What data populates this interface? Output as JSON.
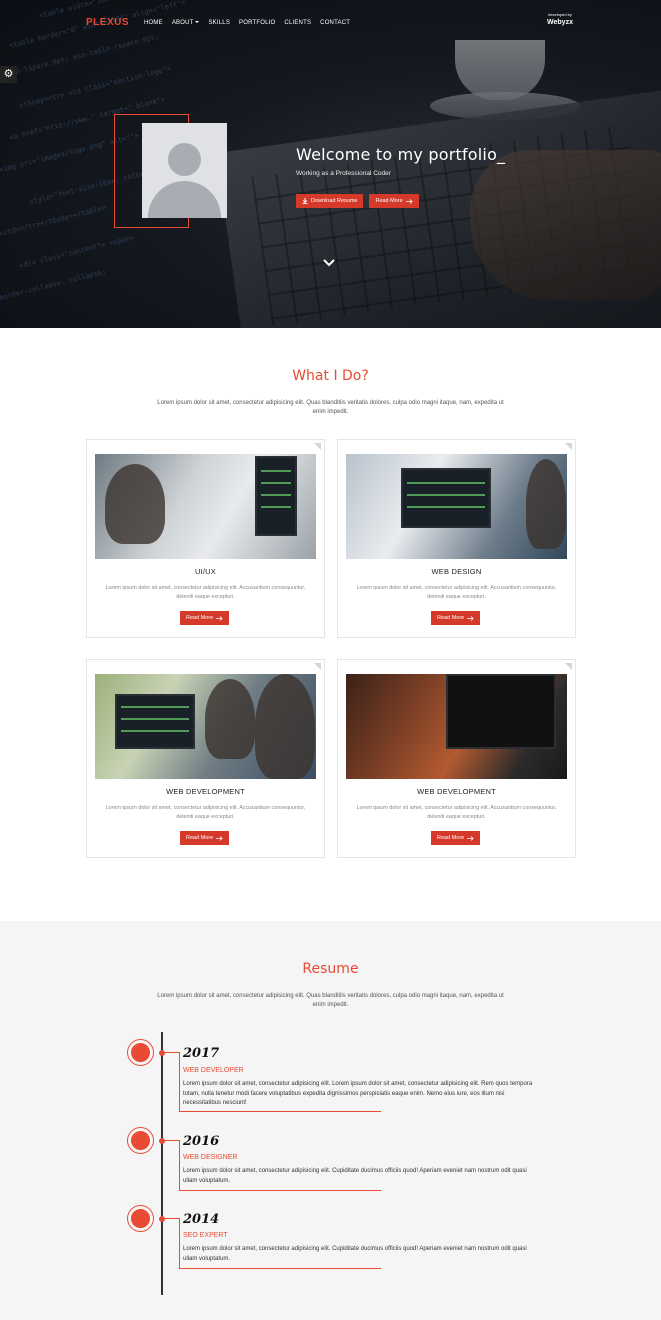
{
  "nav": {
    "logo": "PLEXUS",
    "links": [
      "HOME",
      "ABOUT",
      "SKILLS",
      "PORTFOLIO",
      "CLIENTS",
      "CONTACT"
    ],
    "developed_by": "developed by",
    "developer_brand": "Webyzx"
  },
  "hero": {
    "title": "Welcome to my portfolio_",
    "subtitle": "Working as a Professional Coder",
    "download_label": "Download Resume",
    "read_more_label": "Read More"
  },
  "services": {
    "title": "What I Do?",
    "description": "Lorem ipsum dolor sit amet, consectetur adipisicing elit. Quas blanditiis veritatis dolores, culpa odio magni itaque, nam, expedita ut enim impedit.",
    "cards": [
      {
        "title": "UI/UX",
        "desc": "Lorem ipsum dolor sit amet, consectetur adipisicing elit. Accusantium consequuntur, deleniti eaque excepturi.",
        "button": "Read More"
      },
      {
        "title": "WEB DESIGN",
        "desc": "Lorem ipsum dolor sit amet, consectetur adipisicing elit. Accusantium consequuntur, deleniti eaque excepturi.",
        "button": "Read More"
      },
      {
        "title": "WEB DEVELOPMENT",
        "desc": "Lorem ipsum dolor sit amet, consectetur adipisicing elit. Accusantium consequuntur, deleniti eaque excepturi.",
        "button": "Read More"
      },
      {
        "title": "WEB DEVELOPMENT",
        "desc": "Lorem ipsum dolor sit amet, consectetur adipisicing elit. Accusantium consequuntur, deleniti eaque excepturi.",
        "button": "Read More"
      }
    ]
  },
  "resume": {
    "title": "Resume",
    "description": "Lorem ipsum dolor sit amet, consectetur adipisicing elit. Quas blanditiis veritatis dolores, culpa odio magni itaque, nam, expedita ut enim impedit.",
    "entries": [
      {
        "year": "2017",
        "role": "WEB DEVELOPER",
        "text": "Lorem ipsum dolor sit amet, consectetur adipisicing elit. Lorem ipsum dolor sit amet, consectetur adipisicing elit. Rem quos tempora totam, nulla tenetur modi facere voluptatibus expedita dignissimos perspiciatis eaque enim. Nemo eius iure, eos illum nisi necessitatibus nesciunt!"
      },
      {
        "year": "2016",
        "role": "WEB DESIGNER",
        "text": "Lorem ipsum dolor sit amet, consectetur adipisicing elit. Cupiditate ducimus officiis quod! Aperiam eveniet nam nostrum odit quasi ullam voluptatum."
      },
      {
        "year": "2014",
        "role": "SEO EXPERT",
        "text": "Lorem ipsum dolor sit amet, consectetur adipisicing elit. Cupiditate ducimus officiis quod! Aperiam eveniet nam nostrum odit quasi ullam voluptatum."
      }
    ]
  },
  "colors": {
    "accent": "#e84a33",
    "button": "#d5392a",
    "resume_bg": "#f5f5f5"
  },
  "icons": {
    "settings": "gear-icon",
    "download": "download-icon",
    "arrow": "arrow-right-icon",
    "scroll": "chevron-down-icon",
    "avatar": "user-icon"
  }
}
